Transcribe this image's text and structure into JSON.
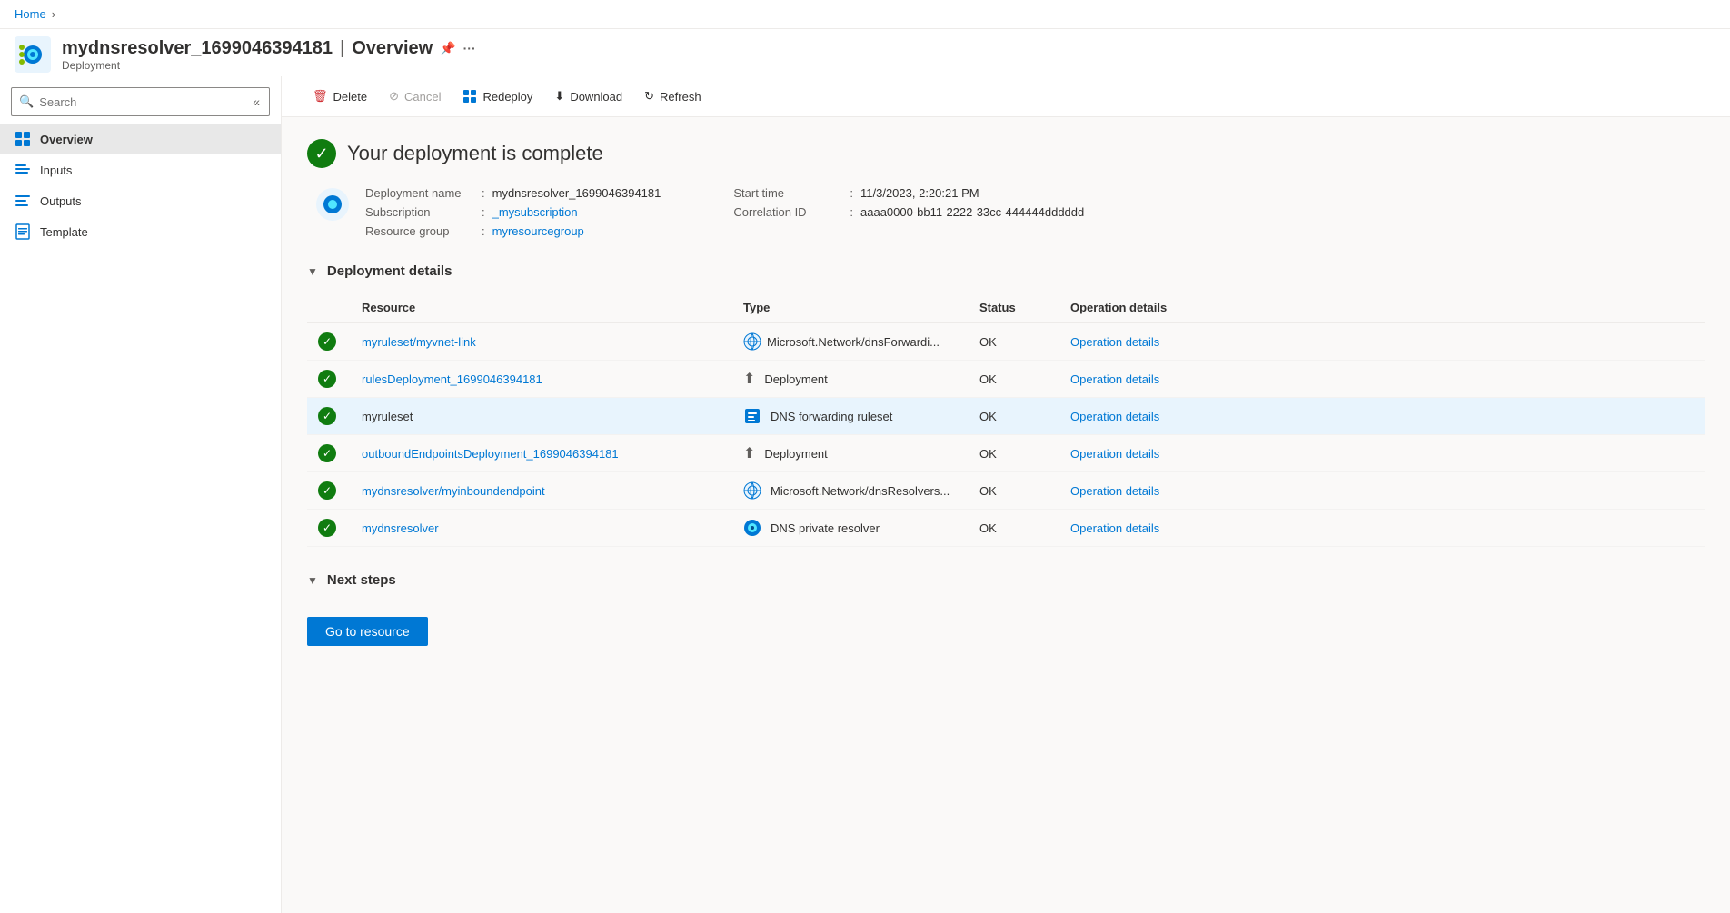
{
  "breadcrumb": {
    "home": "Home"
  },
  "header": {
    "title": "mydnsresolver_1699046394181 | Overview",
    "name": "mydnsresolver_1699046394181",
    "pipe": "Overview",
    "subtitle": "Deployment"
  },
  "toolbar": {
    "delete_label": "Delete",
    "cancel_label": "Cancel",
    "redeploy_label": "Redeploy",
    "download_label": "Download",
    "refresh_label": "Refresh"
  },
  "sidebar": {
    "search_placeholder": "Search",
    "nav_items": [
      {
        "id": "overview",
        "label": "Overview",
        "active": true
      },
      {
        "id": "inputs",
        "label": "Inputs",
        "active": false
      },
      {
        "id": "outputs",
        "label": "Outputs",
        "active": false
      },
      {
        "id": "template",
        "label": "Template",
        "active": false
      }
    ]
  },
  "overview": {
    "status_title": "Your deployment is complete",
    "deployment_name_label": "Deployment name",
    "deployment_name_value": "mydnsresolver_1699046394181",
    "subscription_label": "Subscription",
    "subscription_value": "_mysubscription",
    "resource_group_label": "Resource group",
    "resource_group_value": "myresourcegroup",
    "start_time_label": "Start time",
    "start_time_value": "11/3/2023, 2:20:21 PM",
    "correlation_id_label": "Correlation ID",
    "correlation_id_value": "aaaa0000-bb11-2222-33cc-444444dddddd",
    "deployment_details_label": "Deployment details",
    "table_headers": {
      "resource": "Resource",
      "type": "Type",
      "status": "Status",
      "operation_details": "Operation details"
    },
    "table_rows": [
      {
        "id": "row1",
        "resource": "myruleset/myvnet-link",
        "resource_link": true,
        "type_icon": "network",
        "type": "Microsoft.Network/dnsForwardi...",
        "status": "OK",
        "operation_details": "Operation details",
        "highlighted": false
      },
      {
        "id": "row2",
        "resource": "rulesDeployment_1699046394181",
        "resource_link": true,
        "type_icon": "deployment",
        "type": "Deployment",
        "status": "OK",
        "operation_details": "Operation details",
        "highlighted": false
      },
      {
        "id": "row3",
        "resource": "myruleset",
        "resource_link": false,
        "type_icon": "ruleset",
        "type": "DNS forwarding ruleset",
        "status": "OK",
        "operation_details": "Operation details",
        "highlighted": true
      },
      {
        "id": "row4",
        "resource": "outboundEndpointsDeployment_1699046394181",
        "resource_link": true,
        "type_icon": "deployment",
        "type": "Deployment",
        "status": "OK",
        "operation_details": "Operation details",
        "highlighted": false
      },
      {
        "id": "row5",
        "resource": "mydnsresolver/myinboundendpoint",
        "resource_link": true,
        "type_icon": "network",
        "type": "Microsoft.Network/dnsResolvers...",
        "status": "OK",
        "operation_details": "Operation details",
        "highlighted": false
      },
      {
        "id": "row6",
        "resource": "mydnsresolver",
        "resource_link": true,
        "type_icon": "resolver",
        "type": "DNS private resolver",
        "status": "OK",
        "operation_details": "Operation details",
        "highlighted": false
      }
    ],
    "next_steps_label": "Next steps",
    "go_to_resource_label": "Go to resource"
  }
}
